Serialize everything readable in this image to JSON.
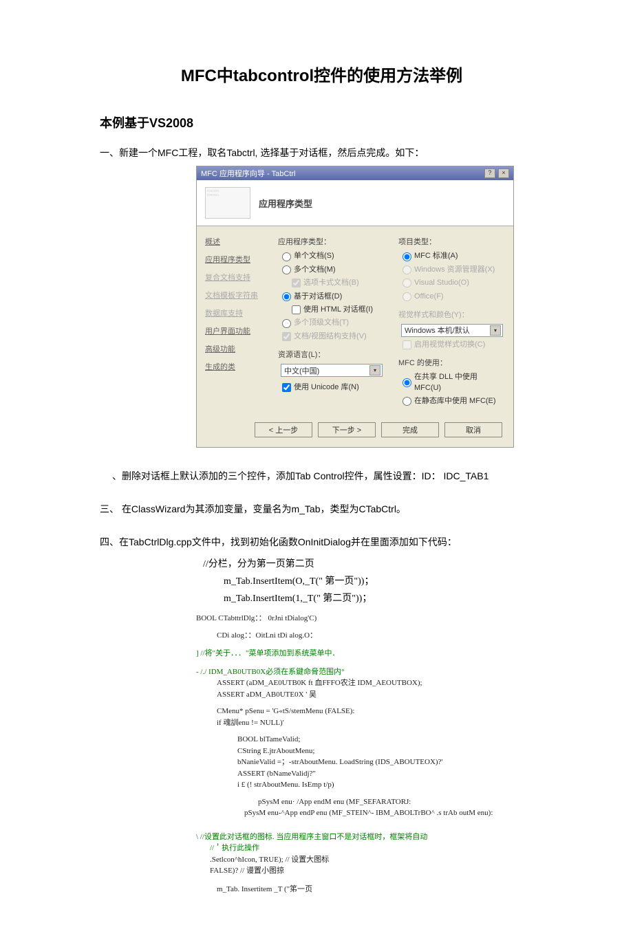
{
  "title": "MFC中tabcontrol控件的使用方法举例",
  "subtitle": "本例基于VS2008",
  "step1": "一、新建一个MFC工程，取名Tabctrl, 选择基于对话框，然后点完成。如下：",
  "wizard": {
    "titlebar": "MFC 应用程序向导 - TabCtrl",
    "header_title": "应用程序类型",
    "sidebar": {
      "i1": "概述",
      "i2": "应用程序类型",
      "i3": "复合文档支持",
      "i4": "文档模板字符串",
      "i5": "数据库支持",
      "i6": "用户界面功能",
      "i7": "高级功能",
      "i8": "生成的类"
    },
    "col1": {
      "g1": "应用程序类型：",
      "r1": "单个文档(S)",
      "r2": "多个文档(M)",
      "c1": "选项卡式文档(B)",
      "r3": "基于对话框(D)",
      "c2": "使用 HTML 对话框(I)",
      "r4": "多个顶级文档(T)",
      "c3": "文档/视图结构支持(V)",
      "g2": "资源语言(L)：",
      "sel1": "中文(中国)",
      "c4": "使用 Unicode 库(N)"
    },
    "col2": {
      "g1": "项目类型：",
      "r1": "MFC 标准(A)",
      "r2": "Windows 资源管理器(X)",
      "r3": "Visual Studio(O)",
      "r4": "Office(F)",
      "g2": "视觉样式和颜色(Y)：",
      "sel1": "Windows 本机/默认",
      "c1": "启用视觉样式切换(C)",
      "g3": "MFC 的使用：",
      "r5": "在共享 DLL 中使用 MFC(U)",
      "r6": "在静态库中使用 MFC(E)"
    },
    "footer": {
      "b1": "< 上一步",
      "b2": "下一步 >",
      "b3": "完成",
      "b4": "取消"
    }
  },
  "step2": "、删除对话框上默认添加的三个控件，添加Tab Control控件，属性设置：ID： IDC_TAB1",
  "step3": "三、  在ClassWizard为其添加变量，变量名为m_Tab，类型为CTabCtrl。",
  "step4": "四、在TabCtrlDlg.cpp文件中，找到初始化函数OnInitDialog并在里面添加如下代码：",
  "code1": {
    "l1": "//分栏，分为第一页第二页",
    "l2": "m_Tab.InsertItem(O,_T(\" 第一页\"))；",
    "l3": "m_Tab.InsertItem(1,_T(\" 第二页\"))；"
  },
  "code2": {
    "l1": "BOOL CTabttrlDlg：： 0rJni tDialog'C)",
    "l2": "CDi alog：：OitLni tDi alog.O：",
    "l3": "]      //将\"关于．．．\"菜单项添加到系统菜单中．",
    "l4": "- /./ IDM_AB0UTB0X必须在系鍵命脅范围内°",
    "l5": "ASSERT (aDM_AE0UTB0K ft 血FFFO农注  IDM_AEOUTBOX);",
    "l6": "ASSERT aDM_AB0UTE0X '            吴",
    "l7": "CMenu* pSenu = 'G«tS/stemMenu (FALSE):",
    "l8": "if 魂訓enu != NULL)'",
    "l9": "BOOL blTameValid;",
    "l10": "CString E.jtrAboutMenu;",
    "l11": "bNanieValid =；-strAboutMenu. LoadString (IDS_ABOUTEOX)?'",
    "l12": "ASSERT (bNameValidj?\"",
    "l13": "i £ (! strAboutMenu. IsEmp t/p)",
    "l14": "pSysM enu· /App endM enu (MF_SEFARATORJ:",
    "l15": "pSysM enu-^App endP enu (MF_STEIN^- IBM_ABOLTrBO^ .s trAb outM enu):",
    "l16": "\\        //设置此对话框的图标. 当应用程序主窗口不是对话框时，框架将自动",
    "l17": "//＇执行此操作",
    "l18": ".Setlcon^hIcon, TRUE);                               //  设置大图标",
    "l19": "                          FALSE)?                  //  谩置小图掠",
    "l20": "m_Tab. Insertitem          _T (\"笫一页"
  }
}
